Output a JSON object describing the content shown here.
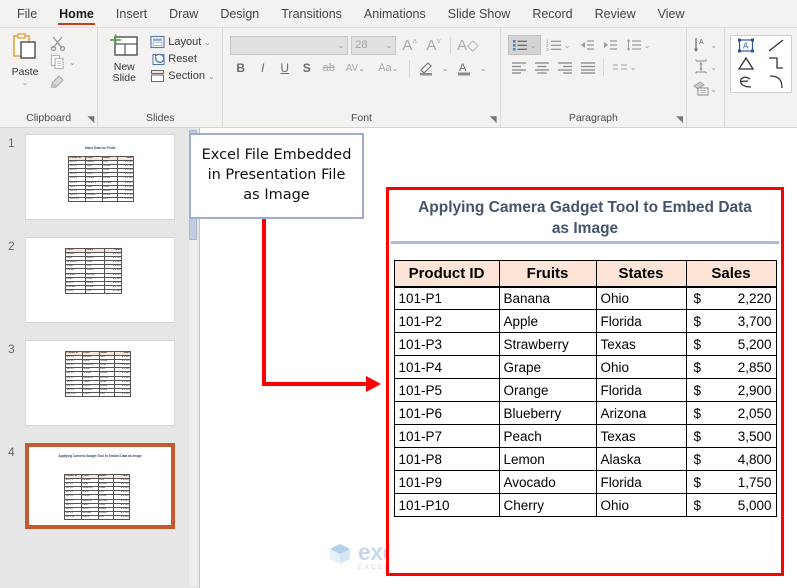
{
  "ribbon": {
    "tabs": [
      {
        "label": "File",
        "active": false
      },
      {
        "label": "Home",
        "active": true
      },
      {
        "label": "Insert",
        "active": false
      },
      {
        "label": "Draw",
        "active": false
      },
      {
        "label": "Design",
        "active": false
      },
      {
        "label": "Transitions",
        "active": false
      },
      {
        "label": "Animations",
        "active": false
      },
      {
        "label": "Slide Show",
        "active": false
      },
      {
        "label": "Record",
        "active": false
      },
      {
        "label": "Review",
        "active": false
      },
      {
        "label": "View",
        "active": false
      }
    ],
    "groups": {
      "clipboard": {
        "label": "Clipboard",
        "paste": "Paste",
        "cut_icon": "scissors-icon",
        "copy_icon": "copy-icon",
        "format_painter_icon": "format-painter-icon"
      },
      "slides": {
        "label": "Slides",
        "new_slide": "New Slide",
        "layout": "Layout",
        "reset": "Reset",
        "section": "Section"
      },
      "font": {
        "label": "Font",
        "font_name_value": "",
        "font_size_value": "28",
        "bold": "B",
        "italic": "I",
        "underline": "U",
        "shadow": "S",
        "strikethrough": "ab",
        "char_spacing": "AV",
        "change_case": "Aa",
        "grow_font_icon": "grow-font-icon",
        "shrink_font_icon": "shrink-font-icon",
        "clear_format_icon": "clear-formatting-icon",
        "text_highlight_icon": "text-highlight-icon",
        "font_color_icon": "font-color-icon"
      },
      "paragraph": {
        "label": "Paragraph",
        "bullets_icon": "bullet-list-icon",
        "numbering_icon": "numbered-list-icon",
        "decrease_indent_icon": "decrease-indent-icon",
        "increase_indent_icon": "increase-indent-icon",
        "line_spacing_icon": "line-spacing-icon",
        "text_direction_icon": "text-direction-icon",
        "align_text_icon": "align-text-icon",
        "smartart_icon": "convert-to-smartart-icon",
        "align_left_icon": "align-left-icon",
        "align_center_icon": "align-center-icon",
        "align_right_icon": "align-right-icon",
        "justify_icon": "justify-icon",
        "columns_icon": "columns-icon"
      },
      "drawing": {
        "label": "",
        "shapes": [
          "text-box-shape",
          "line-shape",
          "triangle-shape",
          "elbow-connector-shape",
          "scribble-shape",
          "arc-shape"
        ]
      }
    }
  },
  "slide_panel": {
    "slides": [
      {
        "number": "1",
        "selected": false,
        "has_title": true,
        "title": "Sales Data for Fruits",
        "columns": 4
      },
      {
        "number": "2",
        "selected": false,
        "has_title": false,
        "title": "",
        "columns": 3
      },
      {
        "number": "3",
        "selected": false,
        "has_title": false,
        "title": "",
        "columns": 4
      },
      {
        "number": "4",
        "selected": true,
        "has_title": true,
        "title": "Applying Camera Gadget Tool to Embed Data as Image",
        "columns": 4
      }
    ]
  },
  "callout": {
    "text": "Excel File Embedded in Presentation File as Image",
    "lines": [
      "Excel File Embedded",
      "in Presentation File",
      "as Image"
    ],
    "border_color": "#9dadcb"
  },
  "connector": {
    "color": "#ff0000",
    "icon": "elbow-arrow-connector"
  },
  "embedded_image": {
    "border_color": "#ff0000",
    "title": "Applying Camera Gadget Tool to Embed Data as Image",
    "title_color": "#44546a",
    "header_fill": "#fce4d6",
    "headers": [
      "Product ID",
      "Fruits",
      "States",
      "Sales"
    ],
    "rows": [
      {
        "id": "101-P1",
        "fruit": "Banana",
        "state": "Ohio",
        "currency": "$",
        "sales": "2,220"
      },
      {
        "id": "101-P2",
        "fruit": "Apple",
        "state": "Florida",
        "currency": "$",
        "sales": "3,700"
      },
      {
        "id": "101-P3",
        "fruit": "Strawberry",
        "state": "Texas",
        "currency": "$",
        "sales": "5,200"
      },
      {
        "id": "101-P4",
        "fruit": "Grape",
        "state": "Ohio",
        "currency": "$",
        "sales": "2,850"
      },
      {
        "id": "101-P5",
        "fruit": "Orange",
        "state": "Florida",
        "currency": "$",
        "sales": "2,900"
      },
      {
        "id": "101-P6",
        "fruit": "Blueberry",
        "state": "Arizona",
        "currency": "$",
        "sales": "2,050"
      },
      {
        "id": "101-P7",
        "fruit": "Peach",
        "state": "Texas",
        "currency": "$",
        "sales": "3,500"
      },
      {
        "id": "101-P8",
        "fruit": "Lemon",
        "state": "Alaska",
        "currency": "$",
        "sales": "4,800"
      },
      {
        "id": "101-P9",
        "fruit": "Avocado",
        "state": "Florida",
        "currency": "$",
        "sales": "1,750"
      },
      {
        "id": "101-P10",
        "fruit": "Cherry",
        "state": "Ohio",
        "currency": "$",
        "sales": "5,000"
      }
    ]
  },
  "watermark": {
    "main": "exceldemy",
    "sub": "EXCEL · DATA · BI"
  }
}
